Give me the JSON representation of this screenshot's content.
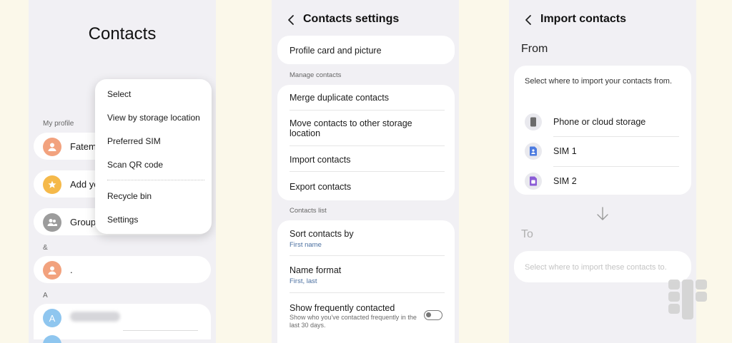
{
  "contacts_screen": {
    "title": "Contacts",
    "my_profile_label": "My profile",
    "rows": [
      {
        "label": "Fatem",
        "avatar_color": "#f2a27e"
      },
      {
        "label": "Add yo",
        "avatar_color": "#f5b94a"
      },
      {
        "label": "Groups",
        "avatar_color": "#9c9c9c"
      }
    ],
    "index_amp": "&",
    "amp_row_label": ".",
    "index_a": "A",
    "a_row_avatar": "A",
    "menu": {
      "items_top": [
        "Select",
        "View by storage location",
        "Preferred SIM",
        "Scan QR code"
      ],
      "items_bottom": [
        "Recycle bin",
        "Settings"
      ]
    }
  },
  "settings_screen": {
    "title": "Contacts settings",
    "profile_card": "Profile card and picture",
    "manage_label": "Manage contacts",
    "manage_items": [
      "Merge duplicate contacts",
      "Move contacts to other storage location",
      "Import contacts",
      "Export contacts"
    ],
    "list_label": "Contacts list",
    "sort_label": "Sort contacts by",
    "sort_value": "First name",
    "format_label": "Name format",
    "format_value": "First, last",
    "frequent_label": "Show frequently contacted",
    "frequent_desc": "Show who you've contacted frequently in the last 30 days.",
    "frequent_on": false
  },
  "import_screen": {
    "title": "Import contacts",
    "from_label": "From",
    "intro": "Select where to import your contacts from.",
    "sources": [
      {
        "label": "Phone or cloud storage",
        "icon": "phone-icon"
      },
      {
        "label": "SIM 1",
        "icon": "sim1-icon"
      },
      {
        "label": "SIM 2",
        "icon": "sim2-icon"
      }
    ],
    "to_label": "To",
    "dest_placeholder": "Select where to import these contacts to."
  },
  "colors": {
    "screen_bg": "#f1f0f4",
    "page_bg": "#fbf8ea",
    "link_blue": "#4a6fa0",
    "sim1": "#4c7be0",
    "sim2": "#8b5cd6"
  }
}
